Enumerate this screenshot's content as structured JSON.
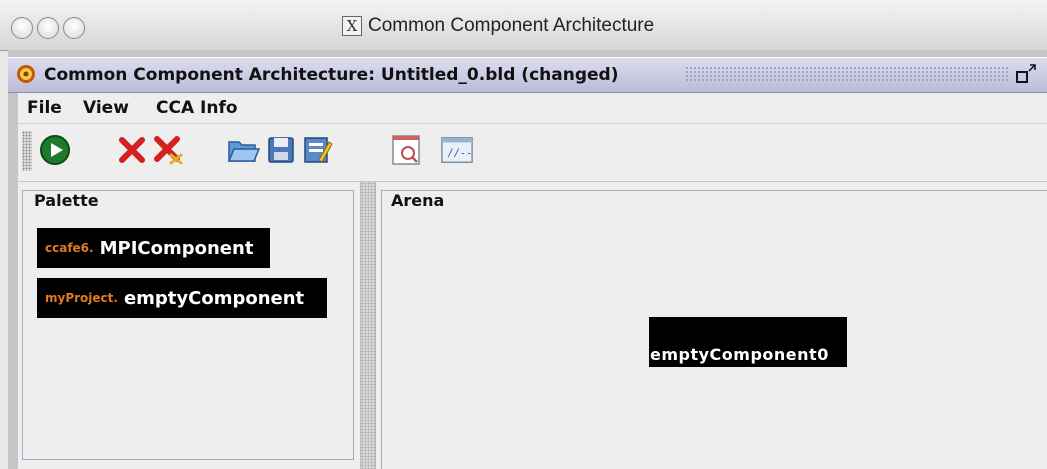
{
  "window": {
    "title": "Common Component Architecture",
    "app_title": "Common Component Architecture: Untitled_0.bld (changed)"
  },
  "menu": [
    "File",
    "View",
    "CCA Info"
  ],
  "toolbar": {
    "buttons": [
      "run-icon",
      "delete-icon",
      "delete-all-icon",
      "open-folder-icon",
      "save-icon",
      "edit-icon",
      "log-window-icon",
      "terminal-window-icon"
    ]
  },
  "palette": {
    "label": "Palette",
    "items": [
      {
        "package": "ccafe6.",
        "name": "MPIComponent"
      },
      {
        "package": "myProject.",
        "name": "emptyComponent"
      }
    ]
  },
  "arena": {
    "label": "Arena",
    "instances": [
      {
        "name": "emptyComponent0"
      }
    ]
  },
  "colors": {
    "package_text": "#e07a20",
    "component_bg": "#000000"
  }
}
